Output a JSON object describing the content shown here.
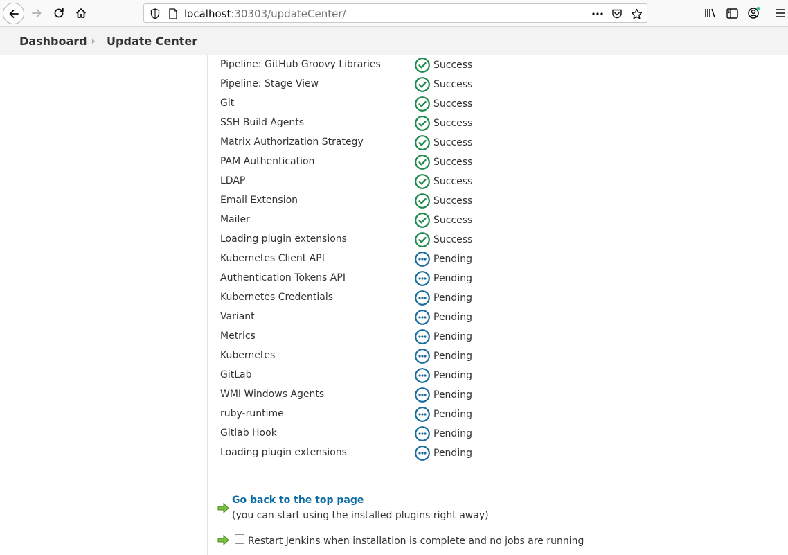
{
  "browser": {
    "url_host": "localhost",
    "url_rest": ":30303/updateCenter/"
  },
  "breadcrumb": {
    "items": [
      "Dashboard",
      "Update Center"
    ]
  },
  "status_labels": {
    "success": "Success",
    "pending": "Pending"
  },
  "colors": {
    "success": "#1e8a4b",
    "pending": "#1b6c9c",
    "link": "#0b6aa2",
    "arrow": "#6db33f"
  },
  "plugins": [
    {
      "name": "Pipeline: GitHub Groovy Libraries",
      "status": "Success"
    },
    {
      "name": "Pipeline: Stage View",
      "status": "Success"
    },
    {
      "name": "Git",
      "status": "Success"
    },
    {
      "name": "SSH Build Agents",
      "status": "Success"
    },
    {
      "name": "Matrix Authorization Strategy",
      "status": "Success"
    },
    {
      "name": "PAM Authentication",
      "status": "Success"
    },
    {
      "name": "LDAP",
      "status": "Success"
    },
    {
      "name": "Email Extension",
      "status": "Success"
    },
    {
      "name": "Mailer",
      "status": "Success"
    },
    {
      "name": "Loading plugin extensions",
      "status": "Success"
    },
    {
      "name": "Kubernetes Client API",
      "status": "Pending"
    },
    {
      "name": "Authentication Tokens API",
      "status": "Pending"
    },
    {
      "name": "Kubernetes Credentials",
      "status": "Pending"
    },
    {
      "name": "Variant",
      "status": "Pending"
    },
    {
      "name": "Metrics",
      "status": "Pending"
    },
    {
      "name": "Kubernetes",
      "status": "Pending"
    },
    {
      "name": "GitLab",
      "status": "Pending"
    },
    {
      "name": "WMI Windows Agents",
      "status": "Pending"
    },
    {
      "name": "ruby-runtime",
      "status": "Pending"
    },
    {
      "name": "Gitlab Hook",
      "status": "Pending"
    },
    {
      "name": "Loading plugin extensions",
      "status": "Pending"
    }
  ],
  "actions": {
    "top_link": "Go back to the top page",
    "top_note": "(you can start using the installed plugins right away)",
    "restart_label": "Restart Jenkins when installation is complete and no jobs are running",
    "restart_checked": false
  }
}
